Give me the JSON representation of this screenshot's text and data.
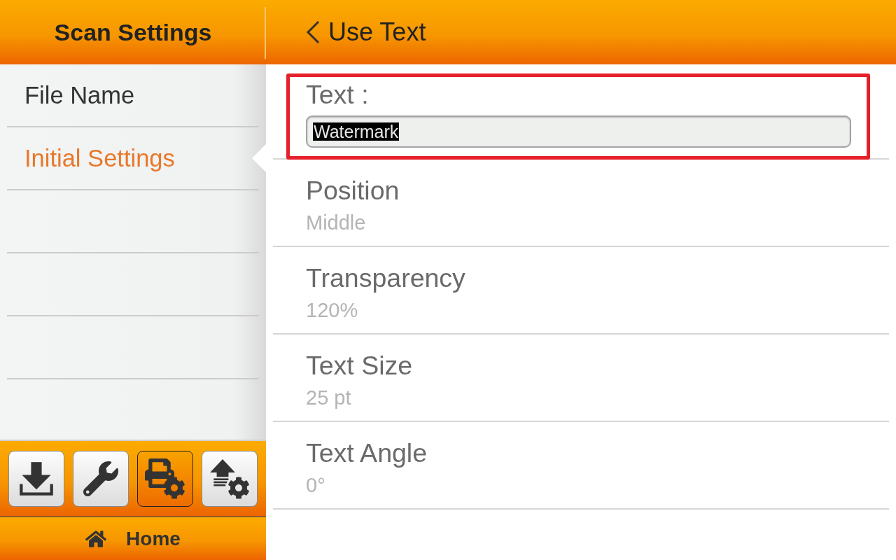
{
  "sidebar": {
    "title": "Scan Settings",
    "items": [
      {
        "label": "File Name",
        "selected": false
      },
      {
        "label": "Initial Settings",
        "selected": true
      }
    ]
  },
  "toolbar": {
    "buttons": [
      {
        "kind": "download",
        "selected": false
      },
      {
        "kind": "tools",
        "selected": false
      },
      {
        "kind": "scan-settings",
        "selected": true
      },
      {
        "kind": "upload-settings",
        "selected": false
      }
    ]
  },
  "home_button": {
    "label": "Home"
  },
  "header": {
    "title": "Use Text"
  },
  "settings": [
    {
      "kind": "text-input",
      "label": "Text :",
      "value": "Watermark",
      "value_selected": true,
      "highlighted": true
    },
    {
      "kind": "option",
      "label": "Position",
      "value": "Middle"
    },
    {
      "kind": "option",
      "label": "Transparency",
      "value": "120%"
    },
    {
      "kind": "option",
      "label": "Text Size",
      "value": "25 pt"
    },
    {
      "kind": "option",
      "label": "Text Angle",
      "value": "0°"
    }
  ]
}
